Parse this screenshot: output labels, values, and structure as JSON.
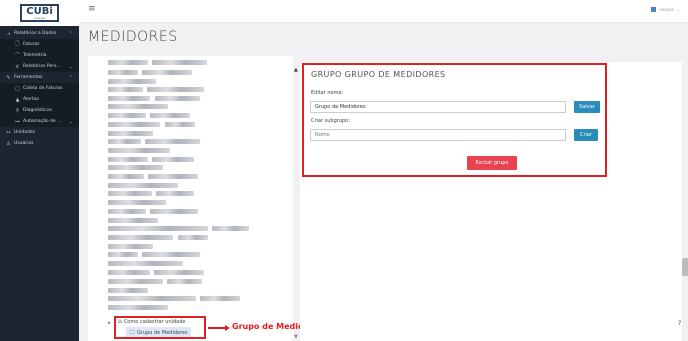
{
  "logo": {
    "text": "CUBi",
    "tagline": "energia"
  },
  "sidebar": {
    "items": [
      {
        "label": "Relatórios e Dados",
        "icon": "chart-icon",
        "glyph": "⩘",
        "chevron": "⌃",
        "level": 1
      },
      {
        "label": "Faturas",
        "icon": "document-icon",
        "glyph": "🗋",
        "level": 2
      },
      {
        "label": "Telemetria",
        "icon": "telemetry-icon",
        "glyph": "⌒",
        "level": 2
      },
      {
        "label": "Relatórios Pers...",
        "icon": "filter-icon",
        "glyph": "⚟",
        "chevron": "⌄",
        "level": 2
      },
      {
        "label": "Ferramentas",
        "icon": "tool-icon",
        "glyph": "✎",
        "chevron": "⌃",
        "level": 1
      },
      {
        "label": "Coleta de Faturas",
        "icon": "collect-icon",
        "glyph": "▢",
        "level": 2
      },
      {
        "label": "Alertas",
        "icon": "alert-icon",
        "glyph": "▲",
        "level": 2
      },
      {
        "label": "Diagnósticos",
        "icon": "diagnostics-icon",
        "glyph": "⚲",
        "level": 2
      },
      {
        "label": "Automação de ...",
        "icon": "automation-icon",
        "glyph": "⊶",
        "chevron": "⌄",
        "level": 2
      },
      {
        "label": "Unidades",
        "icon": "units-icon",
        "glyph": "⚯",
        "level": 1
      },
      {
        "label": "Usuários",
        "icon": "user-icon",
        "glyph": "♙",
        "level": 1
      }
    ]
  },
  "topbar": {
    "menu_icon": "≡",
    "user_name": "xxxxxx"
  },
  "page": {
    "title": "MEDIDORES"
  },
  "tree": {
    "root_label": "Como cadastrar unidade",
    "child_label": "Grupo de Medidores",
    "folder_glyph": "🗀",
    "home_glyph": "⌂",
    "bullet": "▸"
  },
  "annotation": {
    "text": "Grupo de Medidores criado"
  },
  "panel": {
    "title": "GRUPO GRUPO DE MEDIDORES",
    "edit_label": "Editar nome:",
    "edit_value": "Grupo de Medidores",
    "save_label": "Salvar",
    "subgroup_label": "Criar subgrupo:",
    "subgroup_placeholder": "Nome",
    "create_label": "Criar",
    "delete_label": "Excluir grupo"
  },
  "misc": {
    "scroll_up": "▲",
    "scroll_down": "▼",
    "help": "?"
  }
}
